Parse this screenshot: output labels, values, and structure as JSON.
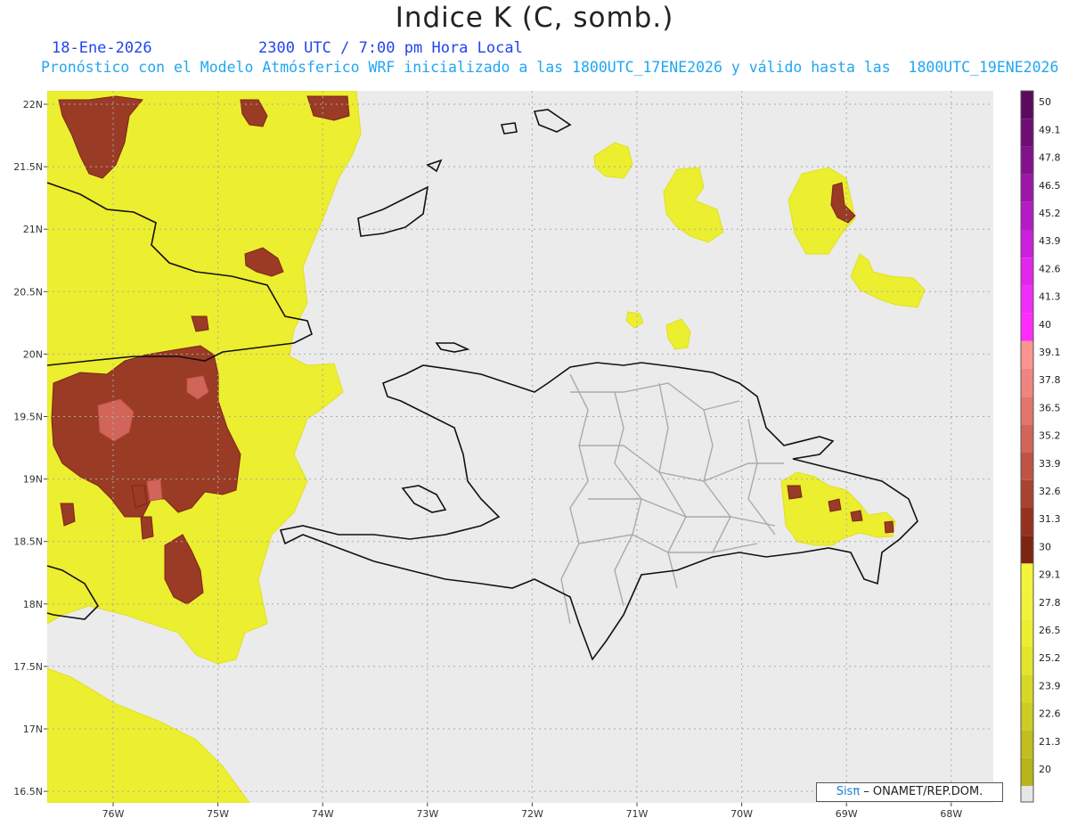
{
  "header": {
    "title": "Indice K (C, somb.)",
    "date": "18-Ene-2026",
    "time": "2300 UTC / 7:00 pm Hora Local",
    "description": "Pronóstico con el Modelo Atmósferico WRF inicializado a las 1800UTC_17ENE2026 y válido hasta las  1800UTC_19ENE2026"
  },
  "map": {
    "lat_labels": [
      "22N",
      "21.5N",
      "21N",
      "20.5N",
      "20N",
      "19.5N",
      "19N",
      "18.5N",
      "18N",
      "17.5N",
      "17N",
      "16.5N"
    ],
    "lon_labels": [
      "76W",
      "75W",
      "74W",
      "73W",
      "72W",
      "71W",
      "70W",
      "69W",
      "68W"
    ],
    "lat_values": [
      22,
      21.5,
      21,
      20.5,
      20,
      19.5,
      19,
      18.5,
      18,
      17.5,
      17,
      16.5
    ],
    "lon_values": [
      -76,
      -75,
      -74,
      -73,
      -72,
      -71,
      -70,
      -69,
      -68
    ],
    "background_color": "#ebebeb",
    "land_border_color": "#aaaaaa",
    "coast_color": "#111111"
  },
  "colorbar": {
    "labels": [
      "50",
      "49.1",
      "47.8",
      "46.5",
      "45.2",
      "43.9",
      "42.6",
      "41.3",
      "40",
      "39.1",
      "37.8",
      "36.5",
      "35.2",
      "33.9",
      "32.6",
      "31.3",
      "30",
      "29.1",
      "27.8",
      "26.5",
      "25.2",
      "23.9",
      "22.6",
      "21.3",
      "20"
    ],
    "colors": [
      "#5c0a5e",
      "#6e0d74",
      "#84118c",
      "#9c16a8",
      "#b51bc4",
      "#cc20dc",
      "#e226ee",
      "#f22cf8",
      "#ff2cff",
      "#f89590",
      "#ee8580",
      "#e2766c",
      "#d2655a",
      "#bf5445",
      "#a84330",
      "#93331f",
      "#7e2512",
      "#f3f53a",
      "#f1f23c",
      "#ecee30",
      "#e2e52c",
      "#d7d825",
      "#cccc22",
      "#c1be1d",
      "#b7b51a"
    ],
    "below_color": "#e6e6e6"
  },
  "credit": {
    "brand": "Sisπ",
    "text": " – ONAMET/REP.DOM."
  }
}
